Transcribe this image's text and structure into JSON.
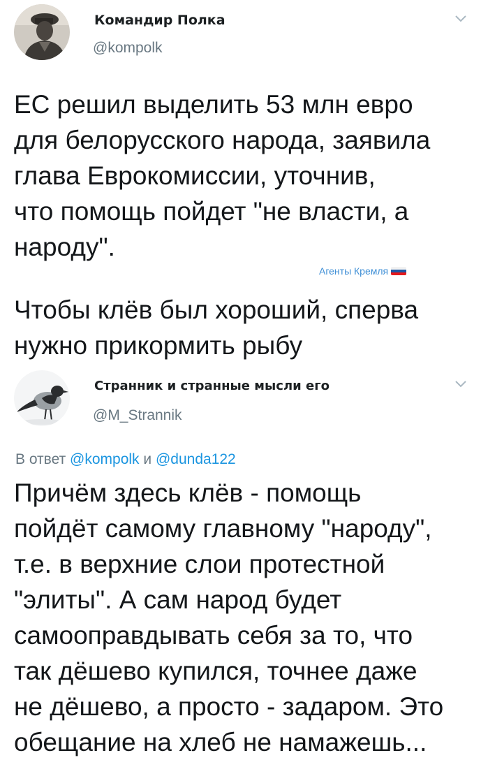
{
  "tweet1": {
    "author_name": "Командир Полка",
    "author_handle": "@kompolk",
    "text": "ЕС решил выделить 53 млн евро\nдля белорусского народа, заявила\nглава Еврокомиссии, уточнив,\nчто помощь пойдет  \"не власти, а\nнароду\".",
    "menu_icon": "chevron-down-icon"
  },
  "watermark": {
    "text": "Агенты Кремля",
    "flag_colors": [
      "#ffffff",
      "#1c57a5",
      "#e4181c"
    ]
  },
  "caption": {
    "text": "Чтобы клёв был хороший, сперва\nнужно прикормить рыбу"
  },
  "tweet2": {
    "author_name": "Странник и странные мысли его",
    "author_handle": "@M_Strannik",
    "reply_prefix": "В ответ",
    "reply_to_1": "@kompolk",
    "reply_and": "и",
    "reply_to_2": "@dunda122",
    "text": "Причём здесь клёв - помощь\nпойдёт самому главному \"народу\",\nт.е. в верхние слои протестной\n\"элиты\". А сам народ будет\nсамооправдывать себя за то, что\nтак дёшево купился, точнее даже\nне дёшево, а просто - задаром. Это\nобещание на хлеб не намажешь...",
    "menu_icon": "chevron-down-icon"
  },
  "colors": {
    "text": "#14171a",
    "secondary": "#697882",
    "link": "#1b95e0",
    "watermark": "#3f8fd6"
  }
}
